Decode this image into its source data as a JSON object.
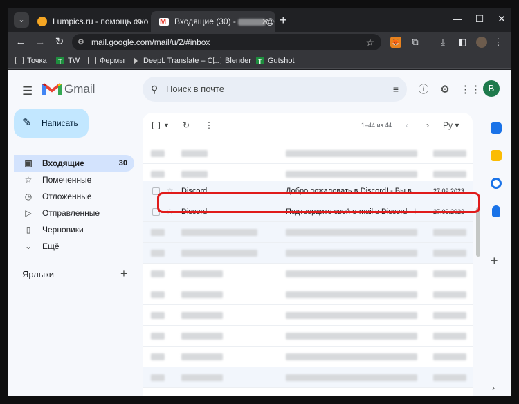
{
  "browser": {
    "tabs": [
      {
        "title": "Lumpics.ru - помощь с компь"
      },
      {
        "title_prefix": "Входящие (30) -",
        "title_suffix": "@gr"
      }
    ],
    "address": "mail.google.com/mail/u/2/#inbox",
    "bookmarks": [
      "Точка",
      "TW",
      "Фермы",
      "DeepL Translate – С...",
      "Blender",
      "Gutshot"
    ]
  },
  "gmail": {
    "logo_text": "Gmail",
    "search_placeholder": "Поиск в почте",
    "avatar_letter": "B",
    "compose_label": "Написать",
    "nav": [
      {
        "label": "Входящие",
        "count": "30",
        "icon": "inbox-icon"
      },
      {
        "label": "Помеченные",
        "icon": "star-icon"
      },
      {
        "label": "Отложенные",
        "icon": "clock-icon"
      },
      {
        "label": "Отправленные",
        "icon": "send-icon"
      },
      {
        "label": "Черновики",
        "icon": "draft-icon"
      },
      {
        "label": "Ещё",
        "icon": "chevron-down-icon"
      }
    ],
    "labels_title": "Ярлыки",
    "toolbar": {
      "pagination": "1–44 из 44",
      "sort": "Ру"
    },
    "emails": [
      {
        "from": "Discord",
        "subject": "Добро пожаловать в Discord! - Вы в...",
        "date": "27.09.2023"
      },
      {
        "from": "Discord",
        "subject": "Подтвердите свой e-mail в Discord - I",
        "date": "27.09.2023"
      }
    ]
  },
  "colors": {
    "accent": "#c2e7ff",
    "highlight": "#e01b1b",
    "selected_nav": "#d3e3fd"
  }
}
